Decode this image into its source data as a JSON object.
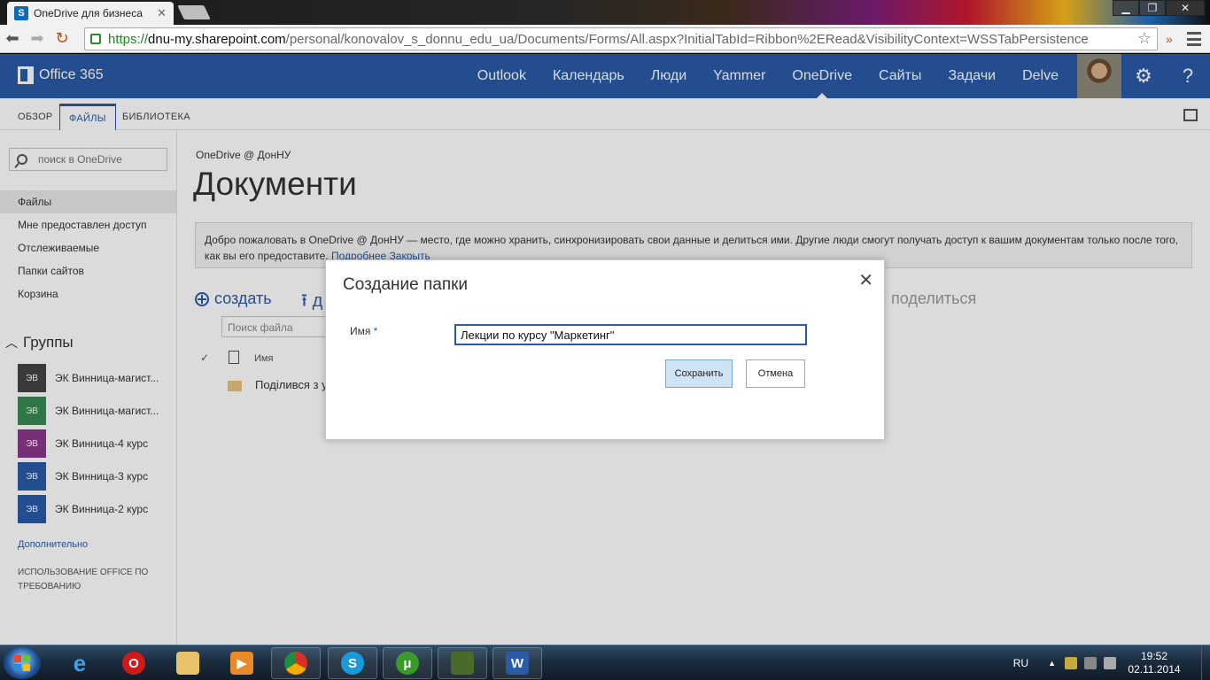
{
  "browser": {
    "tab_title": "OneDrive для бизнеса",
    "tab_close": "✕",
    "url_proto": "https://",
    "url_host": "dnu-my.sharepoint.com",
    "url_path": "/personal/konovalov_s_donnu_edu_ua/Documents/Forms/All.aspx?InitialTabId=Ribbon%2ERead&VisibilityContext=WSSTabPersistence",
    "ext_label": "»"
  },
  "suite": {
    "brand": "Office 365",
    "nav": [
      "Outlook",
      "Календарь",
      "Люди",
      "Yammer",
      "OneDrive",
      "Сайты",
      "Задачи",
      "Delve"
    ],
    "active": "OneDrive"
  },
  "ribbon": {
    "tabs": [
      "ОБЗОР",
      "ФАЙЛЫ",
      "БИБЛИОТЕКА"
    ],
    "active_index": 1
  },
  "leftnav": {
    "search_placeholder": "поиск в OneDrive",
    "items": [
      "Файлы",
      "Мне предоставлен доступ",
      "Отслеживаемые",
      "Папки сайтов",
      "Корзина"
    ],
    "groups_title": "Группы",
    "groups": [
      {
        "abbr": "ЭВ",
        "name": "ЭК Винница-магист...",
        "color": "#444444"
      },
      {
        "abbr": "ЭВ",
        "name": "ЭК Винница-магист...",
        "color": "#3a8a55"
      },
      {
        "abbr": "ЭВ",
        "name": "ЭК Винница-4 курс",
        "color": "#8a3a8a"
      },
      {
        "abbr": "ЭВ",
        "name": "ЭК Винница-3 курс",
        "color": "#2a5aa8"
      },
      {
        "abbr": "ЭВ",
        "name": "ЭК Винница-2 курс",
        "color": "#2a5aa8"
      }
    ],
    "more": "Дополнительно",
    "usage": "ИСПОЛЬЗОВАНИЕ OFFICE ПО ТРЕБОВАНИЮ"
  },
  "main": {
    "breadcrumb": "OneDrive @ ДонНУ",
    "title": "Документи",
    "welcome_text": "Добро пожаловать в OneDrive @ ДонНУ — место, где можно хранить, синхронизировать свои данные и делиться ими. Другие люди смогут получать доступ к вашим документам только после того, как вы его предоставите.",
    "welcome_more": "Подробнее",
    "welcome_close": "Закрыть",
    "create": "создать",
    "upload_partial": "д",
    "share": "поделиться",
    "file_search": "Поиск файла",
    "col_name": "Имя",
    "row_name": "Поділився з у"
  },
  "dialog": {
    "title": "Создание папки",
    "close": "✕",
    "name_label": "Имя",
    "required_mark": "*",
    "name_value": "Лекции по курсу \"Маркетинг\"",
    "save": "Сохранить",
    "cancel": "Отмена"
  },
  "taskbar": {
    "lang": "RU",
    "time": "19:52",
    "date": "02.11.2014"
  },
  "colors": {
    "accent": "#2a5aa8",
    "suitebar": "#2a5aa8"
  }
}
